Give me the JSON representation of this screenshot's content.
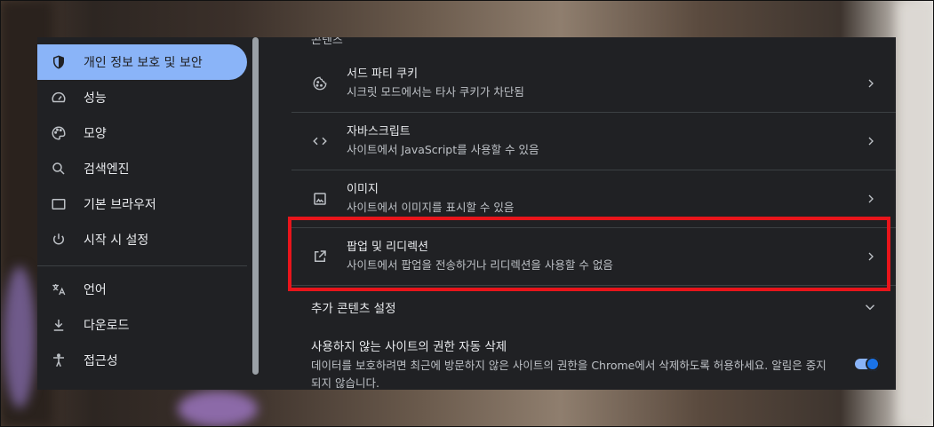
{
  "sidebar": {
    "items": [
      {
        "label": "개인 정보 보호 및 보안",
        "icon": "shield-icon",
        "active": true
      },
      {
        "label": "성능",
        "icon": "speedometer-icon"
      },
      {
        "label": "모양",
        "icon": "palette-icon"
      },
      {
        "label": "검색엔진",
        "icon": "search-icon"
      },
      {
        "label": "기본 브라우저",
        "icon": "browser-window-icon"
      },
      {
        "label": "시작 시 설정",
        "icon": "power-icon"
      },
      {
        "label": "언어",
        "icon": "translate-icon"
      },
      {
        "label": "다운로드",
        "icon": "download-icon"
      },
      {
        "label": "접근성",
        "icon": "accessibility-icon"
      }
    ]
  },
  "content": {
    "partial_header": "콘텐츠",
    "rows": [
      {
        "title": "서드 파티 쿠키",
        "subtitle": "시크릿 모드에서는 타사 쿠키가 차단됨",
        "icon": "cookie-icon"
      },
      {
        "title": "자바스크립트",
        "subtitle": "사이트에서 JavaScript를 사용할 수 있음",
        "icon": "code-icon"
      },
      {
        "title": "이미지",
        "subtitle": "사이트에서 이미지를 표시할 수 있음",
        "icon": "image-icon"
      },
      {
        "title": "팝업 및 리디렉션",
        "subtitle": "사이트에서 팝업을 전송하거나 리디렉션을 사용할 수 없음",
        "icon": "open-in-new-icon"
      }
    ],
    "additional_settings": "추가 콘텐츠 설정",
    "auto_delete": {
      "title": "사용하지 않는 사이트의 권한 자동 삭제",
      "description": "데이터를 보호하려면 최근에 방문하지 않은 사이트의 권한을 Chrome에서 삭제하도록 허용하세요. 알림은 중지되지 않습니다.",
      "enabled": true
    }
  },
  "colors": {
    "accent": "#8ab4f8",
    "highlight": "#e8151b",
    "surface": "#202124"
  }
}
